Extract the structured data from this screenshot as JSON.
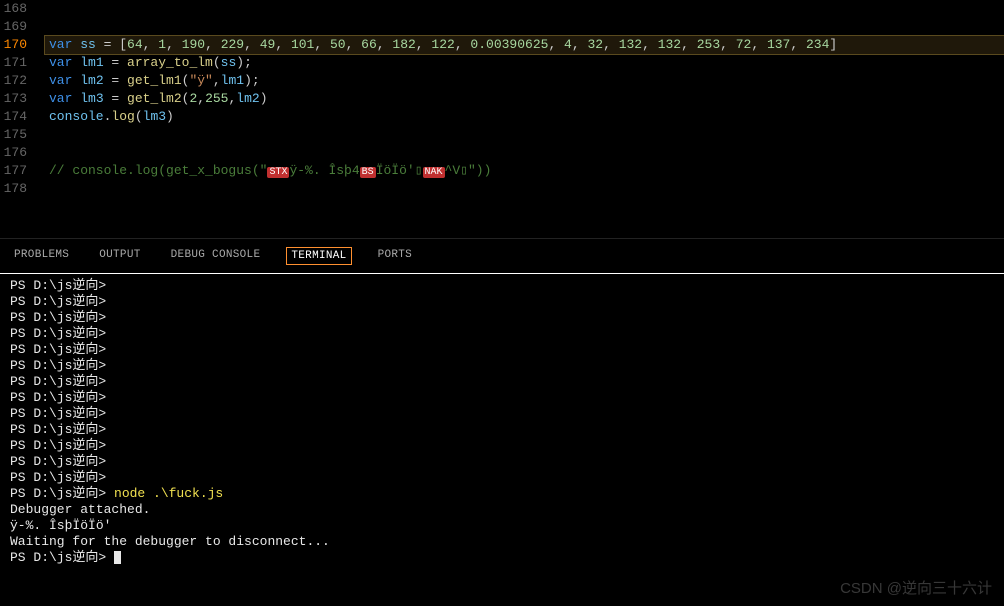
{
  "editor": {
    "lines": [
      {
        "num": "168",
        "active": false,
        "hl": false,
        "tokens": []
      },
      {
        "num": "169",
        "active": false,
        "hl": false,
        "tokens": []
      },
      {
        "num": "170",
        "active": true,
        "hl": true,
        "tokens": [
          {
            "c": "kw",
            "t": "var"
          },
          {
            "c": "punc",
            "t": " "
          },
          {
            "c": "id",
            "t": "ss"
          },
          {
            "c": "punc",
            "t": " = ["
          },
          {
            "c": "num",
            "t": "64"
          },
          {
            "c": "punc",
            "t": ", "
          },
          {
            "c": "num",
            "t": "1"
          },
          {
            "c": "punc",
            "t": ", "
          },
          {
            "c": "num",
            "t": "190"
          },
          {
            "c": "punc",
            "t": ", "
          },
          {
            "c": "num",
            "t": "229"
          },
          {
            "c": "punc",
            "t": ", "
          },
          {
            "c": "num",
            "t": "49"
          },
          {
            "c": "punc",
            "t": ", "
          },
          {
            "c": "num",
            "t": "101"
          },
          {
            "c": "punc",
            "t": ", "
          },
          {
            "c": "num",
            "t": "50"
          },
          {
            "c": "punc",
            "t": ", "
          },
          {
            "c": "num",
            "t": "66"
          },
          {
            "c": "punc",
            "t": ", "
          },
          {
            "c": "num",
            "t": "182"
          },
          {
            "c": "punc",
            "t": ", "
          },
          {
            "c": "num",
            "t": "122"
          },
          {
            "c": "punc",
            "t": ", "
          },
          {
            "c": "num",
            "t": "0.00390625"
          },
          {
            "c": "punc",
            "t": ", "
          },
          {
            "c": "num",
            "t": "4"
          },
          {
            "c": "punc",
            "t": ", "
          },
          {
            "c": "num",
            "t": "32"
          },
          {
            "c": "punc",
            "t": ", "
          },
          {
            "c": "num",
            "t": "132"
          },
          {
            "c": "punc",
            "t": ", "
          },
          {
            "c": "num",
            "t": "132"
          },
          {
            "c": "punc",
            "t": ", "
          },
          {
            "c": "num",
            "t": "253"
          },
          {
            "c": "punc",
            "t": ", "
          },
          {
            "c": "num",
            "t": "72"
          },
          {
            "c": "punc",
            "t": ", "
          },
          {
            "c": "num",
            "t": "137"
          },
          {
            "c": "punc",
            "t": ", "
          },
          {
            "c": "num",
            "t": "234"
          },
          {
            "c": "punc",
            "t": "]"
          }
        ]
      },
      {
        "num": "171",
        "active": false,
        "hl": false,
        "tokens": [
          {
            "c": "kw",
            "t": "var"
          },
          {
            "c": "punc",
            "t": " "
          },
          {
            "c": "id",
            "t": "lm1"
          },
          {
            "c": "punc",
            "t": " = "
          },
          {
            "c": "fn",
            "t": "array_to_lm"
          },
          {
            "c": "punc",
            "t": "("
          },
          {
            "c": "id",
            "t": "ss"
          },
          {
            "c": "punc",
            "t": ");"
          }
        ]
      },
      {
        "num": "172",
        "active": false,
        "hl": false,
        "tokens": [
          {
            "c": "kw",
            "t": "var"
          },
          {
            "c": "punc",
            "t": " "
          },
          {
            "c": "id",
            "t": "lm2"
          },
          {
            "c": "punc",
            "t": " = "
          },
          {
            "c": "fn",
            "t": "get_lm1"
          },
          {
            "c": "punc",
            "t": "("
          },
          {
            "c": "str",
            "t": "\"ÿ\""
          },
          {
            "c": "punc",
            "t": ","
          },
          {
            "c": "id",
            "t": "lm1"
          },
          {
            "c": "punc",
            "t": ");"
          }
        ]
      },
      {
        "num": "173",
        "active": false,
        "hl": false,
        "tokens": [
          {
            "c": "kw",
            "t": "var"
          },
          {
            "c": "punc",
            "t": " "
          },
          {
            "c": "id",
            "t": "lm3"
          },
          {
            "c": "punc",
            "t": " = "
          },
          {
            "c": "fn",
            "t": "get_lm2"
          },
          {
            "c": "punc",
            "t": "("
          },
          {
            "c": "num",
            "t": "2"
          },
          {
            "c": "punc",
            "t": ","
          },
          {
            "c": "num",
            "t": "255"
          },
          {
            "c": "punc",
            "t": ","
          },
          {
            "c": "id",
            "t": "lm2"
          },
          {
            "c": "punc",
            "t": ")"
          }
        ]
      },
      {
        "num": "174",
        "active": false,
        "hl": false,
        "tokens": [
          {
            "c": "id",
            "t": "console"
          },
          {
            "c": "punc",
            "t": "."
          },
          {
            "c": "fn",
            "t": "log"
          },
          {
            "c": "punc",
            "t": "("
          },
          {
            "c": "id",
            "t": "lm3"
          },
          {
            "c": "punc",
            "t": ")"
          }
        ]
      },
      {
        "num": "175",
        "active": false,
        "hl": false,
        "tokens": []
      },
      {
        "num": "176",
        "active": false,
        "hl": false,
        "tokens": []
      },
      {
        "num": "177",
        "active": false,
        "hl": false,
        "tokens": [
          {
            "c": "cmt",
            "t": "// console.log(get_x_bogus(\""
          },
          {
            "c": "badge",
            "t": "STX"
          },
          {
            "c": "cmt",
            "t": "ÿ-%. Îsþ4"
          },
          {
            "c": "badge",
            "t": "BS"
          },
          {
            "c": "cmt",
            "t": "ÏöÏö'▯"
          },
          {
            "c": "badge",
            "t": "NAK"
          },
          {
            "c": "cmt",
            "t": "^V▯\"))"
          }
        ]
      },
      {
        "num": "178",
        "active": false,
        "hl": false,
        "tokens": []
      }
    ]
  },
  "panel": {
    "tabs": [
      {
        "label": "PROBLEMS",
        "active": false
      },
      {
        "label": "OUTPUT",
        "active": false
      },
      {
        "label": "DEBUG CONSOLE",
        "active": false
      },
      {
        "label": "TERMINAL",
        "active": true
      },
      {
        "label": "PORTS",
        "active": false
      }
    ]
  },
  "terminal": {
    "prompt": "PS D:\\js逆向>",
    "blank_prompts": 13,
    "cmd_line": {
      "prompt": "PS D:\\js逆向>",
      "cmd": " node .\\fuck.js"
    },
    "output": [
      "Debugger attached.",
      "ÿ-%. ÎsþÏöÏö'",
      "Waiting for the debugger to disconnect..."
    ],
    "final_prompt": "PS D:\\js逆向>"
  },
  "watermark": "CSDN @逆向三十六计"
}
